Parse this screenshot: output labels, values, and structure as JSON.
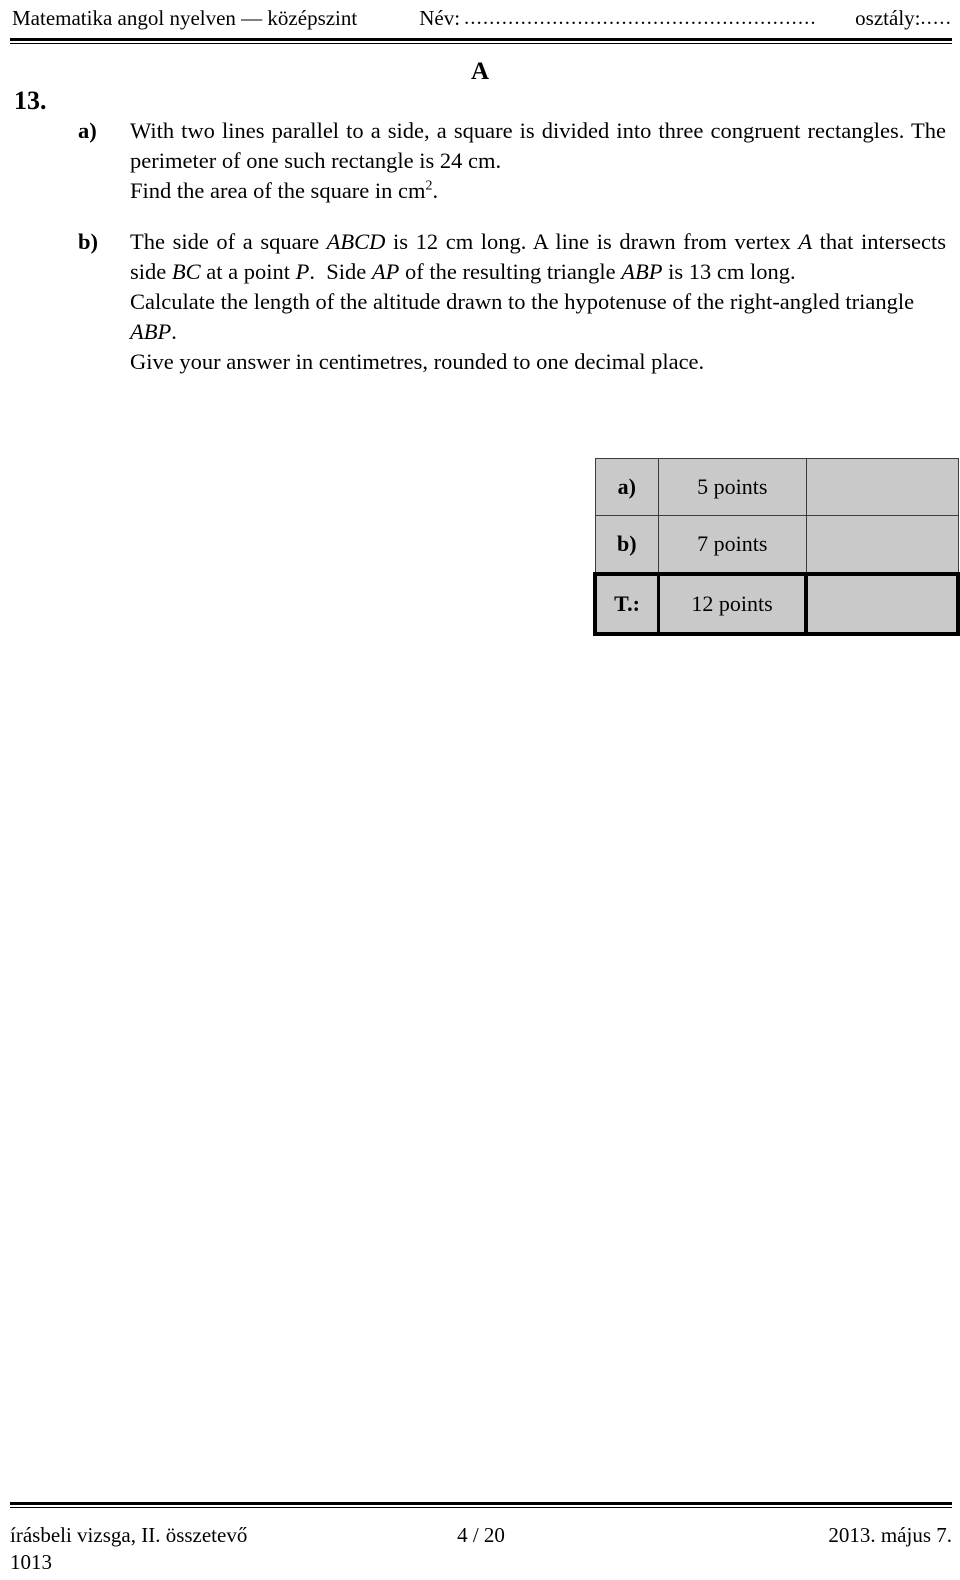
{
  "header": {
    "title": "Matematika angol nyelven — középszint",
    "name_label": "Név:",
    "name_dots": "........................................................",
    "class_label": "osztály:",
    "class_dots": "....."
  },
  "section_label": "A",
  "problem": {
    "number": "13.",
    "parts": [
      {
        "marker": "a)",
        "paragraphs": [
          "With two lines parallel to a side, a square is divided into three congruent rectangles. The perimeter of one such rectangle is 24 cm.",
          "Find the area of the square in cm2."
        ]
      },
      {
        "marker": "b)",
        "paragraphs": [
          "The side of a square ABCD is 12 cm long. A line is drawn from vertex A that intersects side BC at a point P.  Side AP of the resulting triangle ABP is 13 cm long.",
          "Calculate the length of the altitude drawn to the hypotenuse of the right-angled triangle ABP.",
          "Give your answer in centimetres, rounded to one decimal place."
        ]
      }
    ]
  },
  "points_table": {
    "rows": [
      {
        "label": "a)",
        "value": "5 points",
        "blank": ""
      },
      {
        "label": "b)",
        "value": "7 points",
        "blank": ""
      },
      {
        "label": "T.:",
        "value": "12 points",
        "blank": ""
      }
    ],
    "fill_color": "#c9c9c9"
  },
  "footer": {
    "left": "írásbeli vizsga, II. összetevő",
    "center": "4 / 20",
    "right": "2013. május 7.",
    "code": "1013"
  }
}
